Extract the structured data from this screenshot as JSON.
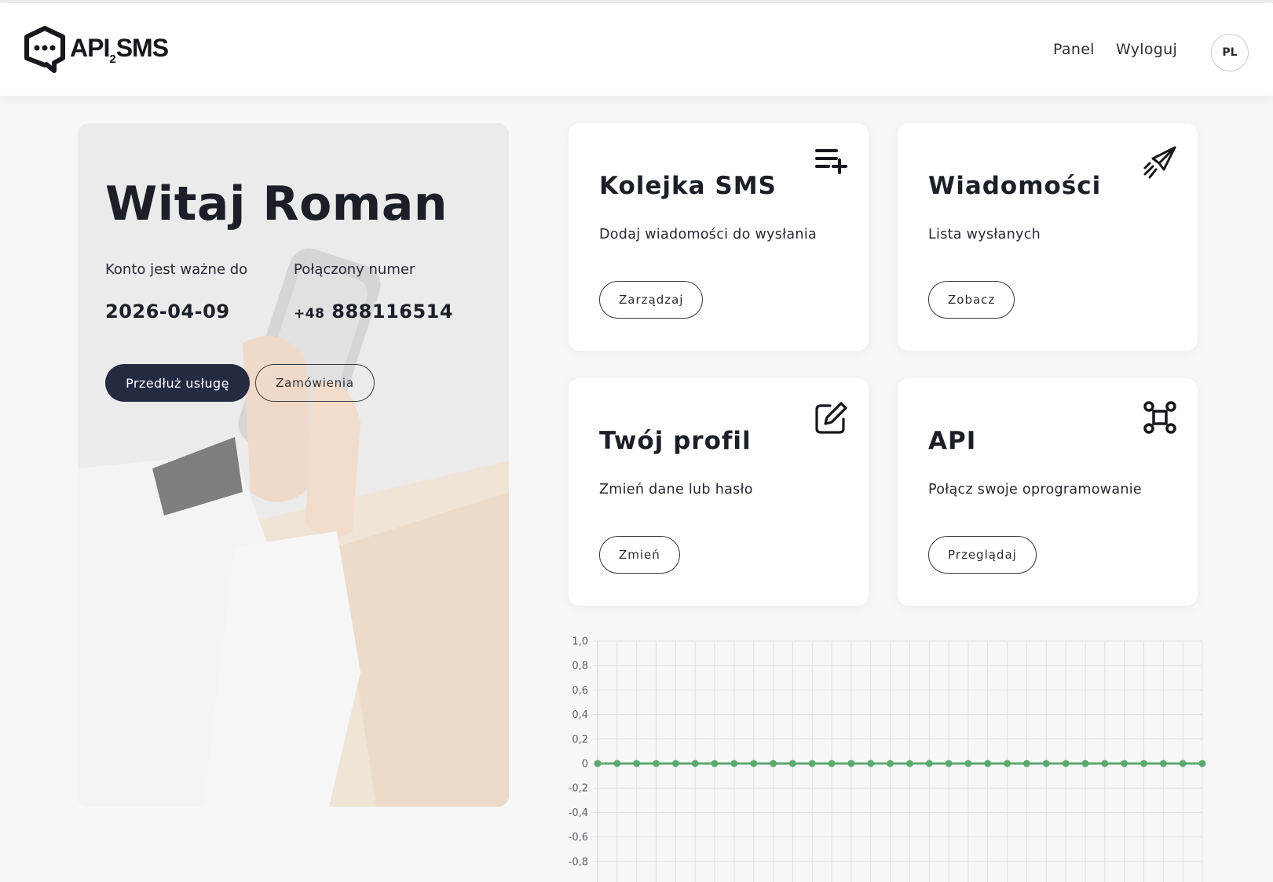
{
  "header": {
    "logo_text": "API",
    "logo_sub": "2",
    "logo_text2": "SMS",
    "nav_panel": "Panel",
    "nav_logout": "Wyloguj",
    "lang": "PL"
  },
  "hero": {
    "title": "Witaj Roman",
    "valid_label": "Konto jest ważne do",
    "valid_value": "2026-04-09",
    "phone_label": "Połączony numer",
    "phone_prefix": "+48",
    "phone_number": "888116514",
    "extend_button": "Przedłuż usługę",
    "orders_button": "Zamówienia"
  },
  "cards": [
    {
      "title": "Kolejka SMS",
      "desc": "Dodaj wiadomości do wysłania",
      "button": "Zarządzaj",
      "icon": "playlist-add-icon"
    },
    {
      "title": "Wiadomości",
      "desc": "Lista wysłanych",
      "button": "Zobacz",
      "icon": "paper-plane-icon"
    },
    {
      "title": "Twój profil",
      "desc": "Zmień dane lub hasło",
      "button": "Zmień",
      "icon": "edit-icon"
    },
    {
      "title": "API",
      "desc": "Połącz swoje oprogramowanie",
      "button": "Przeglądaj",
      "icon": "api-nodes-icon"
    }
  ],
  "colors": {
    "accent_dark": "#242a42",
    "line": "#5aaa6e",
    "grid": "#e0e0e0"
  },
  "chart_data": {
    "type": "line",
    "title": "",
    "xlabel": "",
    "ylabel": "",
    "ylim": [
      -0.8,
      1.0
    ],
    "grid": true,
    "y_ticks": [
      "1,0",
      "0,8",
      "0,6",
      "0,4",
      "0,2",
      "0",
      "-0,2",
      "-0,4",
      "-0,6",
      "-0,8"
    ],
    "series": [
      {
        "values": [
          0,
          0,
          0,
          0,
          0,
          0,
          0,
          0,
          0,
          0,
          0,
          0,
          0,
          0,
          0,
          0,
          0,
          0,
          0,
          0,
          0,
          0,
          0,
          0,
          0,
          0,
          0,
          0,
          0,
          0,
          0,
          0
        ]
      }
    ]
  }
}
